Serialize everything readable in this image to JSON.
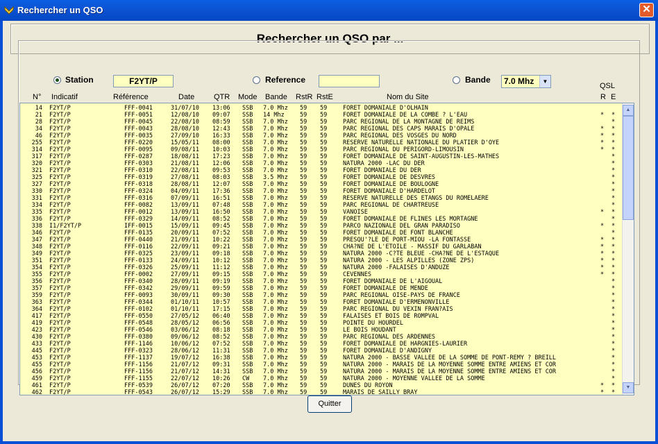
{
  "window": {
    "title": "Rechercher un QSO",
    "heading": "Rechercher un QSO par ..."
  },
  "search": {
    "station_label": "Station",
    "station_value": "F2YT/P",
    "reference_label": "Reference",
    "reference_value": "",
    "band_label": "Bande",
    "band_value": "7.0 Mhz"
  },
  "columns": [
    "N°",
    "Indicatif",
    "Référence",
    "Date",
    "QTR",
    "Mode",
    "Bande",
    "RstR",
    "RstE",
    "Nom du Site"
  ],
  "qsl": {
    "title": "QSL",
    "r": "R",
    "e": "E"
  },
  "rows": [
    [
      "14",
      "F2YT/P",
      "FFF-0041",
      "31/07/10",
      "13:06",
      "SSB",
      "7.0 Mhz",
      "59",
      "59",
      "FORET DOMANIALE D'OLHAIN",
      "",
      ""
    ],
    [
      "21",
      "F2YT/P",
      "FFF-0051",
      "12/08/10",
      "09:07",
      "SSB",
      "14 Mhz",
      "59",
      "59",
      "FORET DOMANIALE DE LA COMBE ? L'EAU",
      "*",
      "*"
    ],
    [
      "28",
      "F2YT/P",
      "FFF-0045",
      "22/08/10",
      "08:59",
      "SSB",
      "7.0 Mhz",
      "59",
      "59",
      "PARC REGIONAL DE LA MONTAGNE DE REIMS",
      "",
      "*"
    ],
    [
      "34",
      "F2YT/P",
      "FFF-0043",
      "28/08/10",
      "12:43",
      "SSB",
      "7.0 Mhz",
      "59",
      "59",
      "PARC REGIONAL DES CAPS MARAIS D'OPALE",
      "*",
      "*"
    ],
    [
      "46",
      "F2YT/P",
      "FFF-0035",
      "27/09/10",
      "16:33",
      "SSB",
      "7.0 Mhz",
      "59",
      "59",
      "PARC REGIONAL DES VOSGES DU NORD",
      "*",
      "*"
    ],
    [
      "255",
      "F2YT/P",
      "FFF-0220",
      "15/05/11",
      "08:00",
      "SSB",
      "7.0 Mhz",
      "59",
      "59",
      "RESERVE NATURELLE NATIONALE DU PLATIER D'OYE",
      "*",
      "*"
    ],
    [
      "314",
      "F2YT/P",
      "FFF-0095",
      "09/08/11",
      "10:03",
      "SSB",
      "7.0 Mhz",
      "59",
      "59",
      "PARC REGIONAL DU PERIGORD-LIMOUSIN",
      "*",
      "*"
    ],
    [
      "317",
      "F2YT/P",
      "FFF-0287",
      "18/08/11",
      "17:23",
      "SSB",
      "7.0 Mhz",
      "59",
      "59",
      "FORET DOMANIALE DE SAINT-AUGUSTIN-LES-MATHES",
      "",
      "*"
    ],
    [
      "320",
      "F2YT/P",
      "FFF-0303",
      "21/08/11",
      "12:06",
      "SSB",
      "7.0 Mhz",
      "59",
      "59",
      "NATURA 2000 -LAC DU DER",
      "",
      "*"
    ],
    [
      "321",
      "F2YT/P",
      "FFF-0310",
      "22/08/11",
      "09:53",
      "SSB",
      "7.0 Mhz",
      "59",
      "59",
      "FORET DOMANIALE DU DER",
      "",
      "*"
    ],
    [
      "325",
      "F2YT/P",
      "FFF-0319",
      "27/08/11",
      "08:03",
      "SSB",
      "3.5 Mhz",
      "59",
      "59",
      "FORET DOMANIALE DE DESVRES",
      "",
      "*"
    ],
    [
      "327",
      "F2YT/P",
      "FFF-0318",
      "28/08/11",
      "12:07",
      "SSB",
      "7.0 Mhz",
      "59",
      "59",
      "FORET DOMANIALE DE BOULOGNE",
      "",
      "*"
    ],
    [
      "330",
      "F2YT/P",
      "FFF-0324",
      "04/09/11",
      "17:36",
      "SSB",
      "7.0 Mhz",
      "59",
      "59",
      "FORET DOMANIALE D'HARDELOT",
      "",
      "*"
    ],
    [
      "331",
      "F2YT/P",
      "FFF-0316",
      "07/09/11",
      "16:51",
      "SSB",
      "7.0 Mhz",
      "59",
      "59",
      "RESERVE NATURELLE DES ETANGS DU ROMELAERE",
      "",
      "*"
    ],
    [
      "334",
      "F2YT/P",
      "FFF-0082",
      "13/09/11",
      "07:48",
      "SSB",
      "7.0 Mhz",
      "59",
      "59",
      "PARC REGIONAL DE CHARTREUSE",
      "",
      "*"
    ],
    [
      "335",
      "F2YT/P",
      "FFF-0012",
      "13/09/11",
      "16:50",
      "SSB",
      "7.0 Mhz",
      "59",
      "59",
      "VANOISE",
      "*",
      "*"
    ],
    [
      "336",
      "F2YT/P",
      "FFF-0329",
      "14/09/11",
      "08:52",
      "SSB",
      "7.0 Mhz",
      "59",
      "59",
      "FORET DOMANIALE DE FLINES LES MORTAGNE",
      "",
      "*"
    ],
    [
      "338",
      "I1/F2YT/P",
      "IFF-0015",
      "15/09/11",
      "09:45",
      "SSB",
      "7.0 Mhz",
      "59",
      "59",
      "PARCO NAZIONALE DEL GRAN PARADISO",
      "*",
      "*"
    ],
    [
      "346",
      "F2YT/P",
      "FFF-0135",
      "20/09/11",
      "07:52",
      "SSB",
      "7.0 Mhz",
      "59",
      "59",
      "FORET DOMANIALE DE FONT BLANCHE",
      "",
      "*"
    ],
    [
      "347",
      "F2YT/P",
      "FFF-0440",
      "21/09/11",
      "10:22",
      "SSB",
      "7.0 Mhz",
      "59",
      "59",
      "PRESQU'?LE DE PORT-MIOU -LA FONTASSE",
      "*",
      "*"
    ],
    [
      "348",
      "F2YT/P",
      "FFF-0116",
      "22/09/11",
      "09:21",
      "SSB",
      "7.0 Mhz",
      "59",
      "59",
      "CHA?NE DE L'ETOILE - MASSIF DU GARLABAN",
      "*",
      "*"
    ],
    [
      "349",
      "F2YT/P",
      "FFF-0325",
      "23/09/11",
      "09:18",
      "SSB",
      "7.0 Mhz",
      "59",
      "59",
      "NATURA 2000 -C?TE BLEUE -CHA?NE DE L'ESTAQUE",
      "*",
      "*"
    ],
    [
      "351",
      "F2YT/P",
      "FFF-0133",
      "24/09/11",
      "10:12",
      "SSB",
      "7.0 Mhz",
      "59",
      "59",
      "NATURA 2000 - LES ALPILLES (ZONE ZPS)",
      "*",
      "*"
    ],
    [
      "354",
      "F2YT/P",
      "FFF-0326",
      "25/09/11",
      "11:12",
      "SSB",
      "7.0 Mhz",
      "59",
      "59",
      "NATURA 2000 -FALAISES D'ANDUZE",
      "*",
      "*"
    ],
    [
      "355",
      "F2YT/P",
      "FFF-0002",
      "27/09/11",
      "09:15",
      "SSB",
      "7.0 Mhz",
      "59",
      "59",
      "CEVENNES",
      "*",
      "*"
    ],
    [
      "356",
      "F2YT/P",
      "FFF-0340",
      "28/09/11",
      "09:19",
      "SSB",
      "7.0 Mhz",
      "59",
      "59",
      "FORET DOMANIALE DE L'AIGOUAL",
      "",
      "*"
    ],
    [
      "357",
      "F2YT/P",
      "FFF-0342",
      "29/09/11",
      "09:59",
      "SSB",
      "7.0 Mhz",
      "59",
      "59",
      "FORET DOMANIALE DE MENDE",
      "",
      "*"
    ],
    [
      "359",
      "F2YT/P",
      "FFF-0093",
      "30/09/11",
      "09:30",
      "SSB",
      "7.0 Mhz",
      "59",
      "59",
      "PARC REGIONAL OISE-PAYS DE FRANCE",
      "",
      "*"
    ],
    [
      "363",
      "F2YT/P",
      "FFF-0344",
      "01/10/11",
      "10:57",
      "SSB",
      "7.0 Mhz",
      "59",
      "59",
      "FORET DOMANIALE D'ERMENONVILLE",
      "",
      "*"
    ],
    [
      "364",
      "F2YT/P",
      "FFF-0102",
      "01/10/11",
      "17:15",
      "SSB",
      "7.0 Mhz",
      "59",
      "59",
      "PARC REGIONAL DU VEXIN FRAN?AIS",
      "",
      "*"
    ],
    [
      "417",
      "F2YT/P",
      "FFF-0550",
      "27/05/12",
      "06:40",
      "SSB",
      "7.0 Mhz",
      "59",
      "59",
      "FALAISES ET BOIS DE ROMPVAL",
      "",
      "*"
    ],
    [
      "419",
      "F2YT/P",
      "FFF-0548",
      "28/05/12",
      "06:56",
      "SSB",
      "7.0 Mhz",
      "59",
      "59",
      "POINTE DU HOURDEL",
      "",
      "*"
    ],
    [
      "423",
      "F2YT/P",
      "FFF-0546",
      "03/06/12",
      "08:18",
      "SSB",
      "7.0 Mhz",
      "59",
      "59",
      "LE BOIS HOUDANT",
      "",
      "*"
    ],
    [
      "430",
      "F2YT/P",
      "FFF-0380",
      "09/06/12",
      "08:52",
      "SSB",
      "7.0 Mhz",
      "59",
      "59",
      "PARC REGIONAL DES ARDENNES",
      "",
      "*"
    ],
    [
      "433",
      "F2YT/P",
      "FFF-1146",
      "10/06/12",
      "07:52",
      "SSB",
      "7.0 Mhz",
      "59",
      "59",
      "FORET DOMANIALE DE HARGNIES-LAURIER",
      "",
      "*"
    ],
    [
      "445",
      "F2YT/P",
      "FFF-0323",
      "28/06/12",
      "11:31",
      "SSB",
      "7.0 Mhz",
      "59",
      "59",
      "FORET DOMANIALE D'ANDIGNY",
      "",
      "*"
    ],
    [
      "453",
      "F2YT/P",
      "FFF-1137",
      "19/07/12",
      "16:38",
      "SSB",
      "7.0 Mhz",
      "59",
      "59",
      "NATURA 2000 - BASSE VALLEE DE LA SOMME DE PONT-REMY ? BREILL",
      "",
      "*"
    ],
    [
      "455",
      "F2YT/P",
      "FFF-1156",
      "21/07/12",
      "09:31",
      "SSB",
      "7.0 Mhz",
      "59",
      "59",
      "NATURA 2000 - MARAIS DE LA MOYENNE SOMME ENTRE AMIENS ET COR",
      "",
      "*"
    ],
    [
      "456",
      "F2YT/P",
      "FFF-1156",
      "21/07/12",
      "14:31",
      "SSB",
      "7.0 Mhz",
      "59",
      "59",
      "NATURA 2000 - MARAIS DE LA MOYENNE SOMME ENTRE AMIENS ET COR",
      "",
      "*"
    ],
    [
      "459",
      "F2YT/P",
      "FFF-1155",
      "22/07/12",
      "10:26",
      "CW",
      "7.0 Mhz",
      "59",
      "59",
      "NATURA 2000 - MOYENNE VALLEE DE LA SOMME",
      "",
      "*"
    ],
    [
      "461",
      "F2YT/P",
      "FFF-0539",
      "26/07/12",
      "07:20",
      "SSB",
      "7.0 Mhz",
      "59",
      "59",
      "DUNES DU ROYON",
      "*",
      "*"
    ],
    [
      "462",
      "F2YT/P",
      "FFF-0543",
      "26/07/12",
      "15:29",
      "SSB",
      "7.0 Mhz",
      "59",
      "59",
      "MARAIS DE SAILLY BRAY",
      "*",
      "*"
    ]
  ],
  "quit_label": "Quitter"
}
